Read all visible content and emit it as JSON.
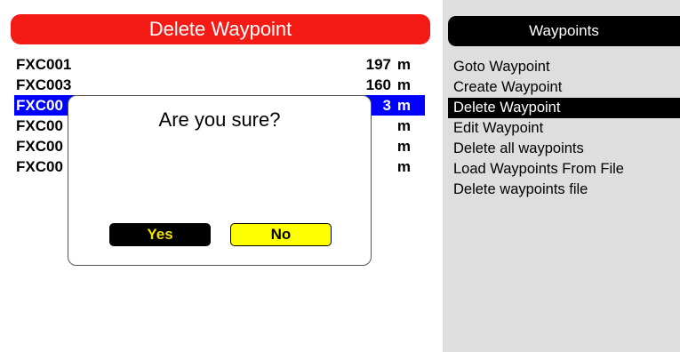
{
  "left_panel": {
    "title": "Delete Waypoint",
    "waypoints": [
      {
        "name": "FXC001",
        "distance": "197",
        "unit": "m"
      },
      {
        "name": "FXC003",
        "distance": "160",
        "unit": "m"
      },
      {
        "name": "FXC00",
        "distance": "3",
        "unit": "m"
      },
      {
        "name": "FXC00",
        "distance": "",
        "unit": "m"
      },
      {
        "name": "FXC00",
        "distance": "",
        "unit": "m"
      },
      {
        "name": "FXC00",
        "distance": "",
        "unit": "m"
      }
    ]
  },
  "dialog": {
    "message": "Are you sure?",
    "yes_label": "Yes",
    "no_label": "No"
  },
  "right_panel": {
    "title": "Waypoints",
    "menu": [
      "Goto Waypoint",
      "Create Waypoint",
      "Delete Waypoint",
      "Edit Waypoint",
      "Delete all waypoints",
      "Load Waypoints From File",
      "Delete waypoints file"
    ]
  },
  "colors": {
    "header_red": "#f41b14",
    "selection_blue": "#0000ff",
    "menu_panel_grey": "#dedede",
    "button_yellow": "#ffff00"
  }
}
